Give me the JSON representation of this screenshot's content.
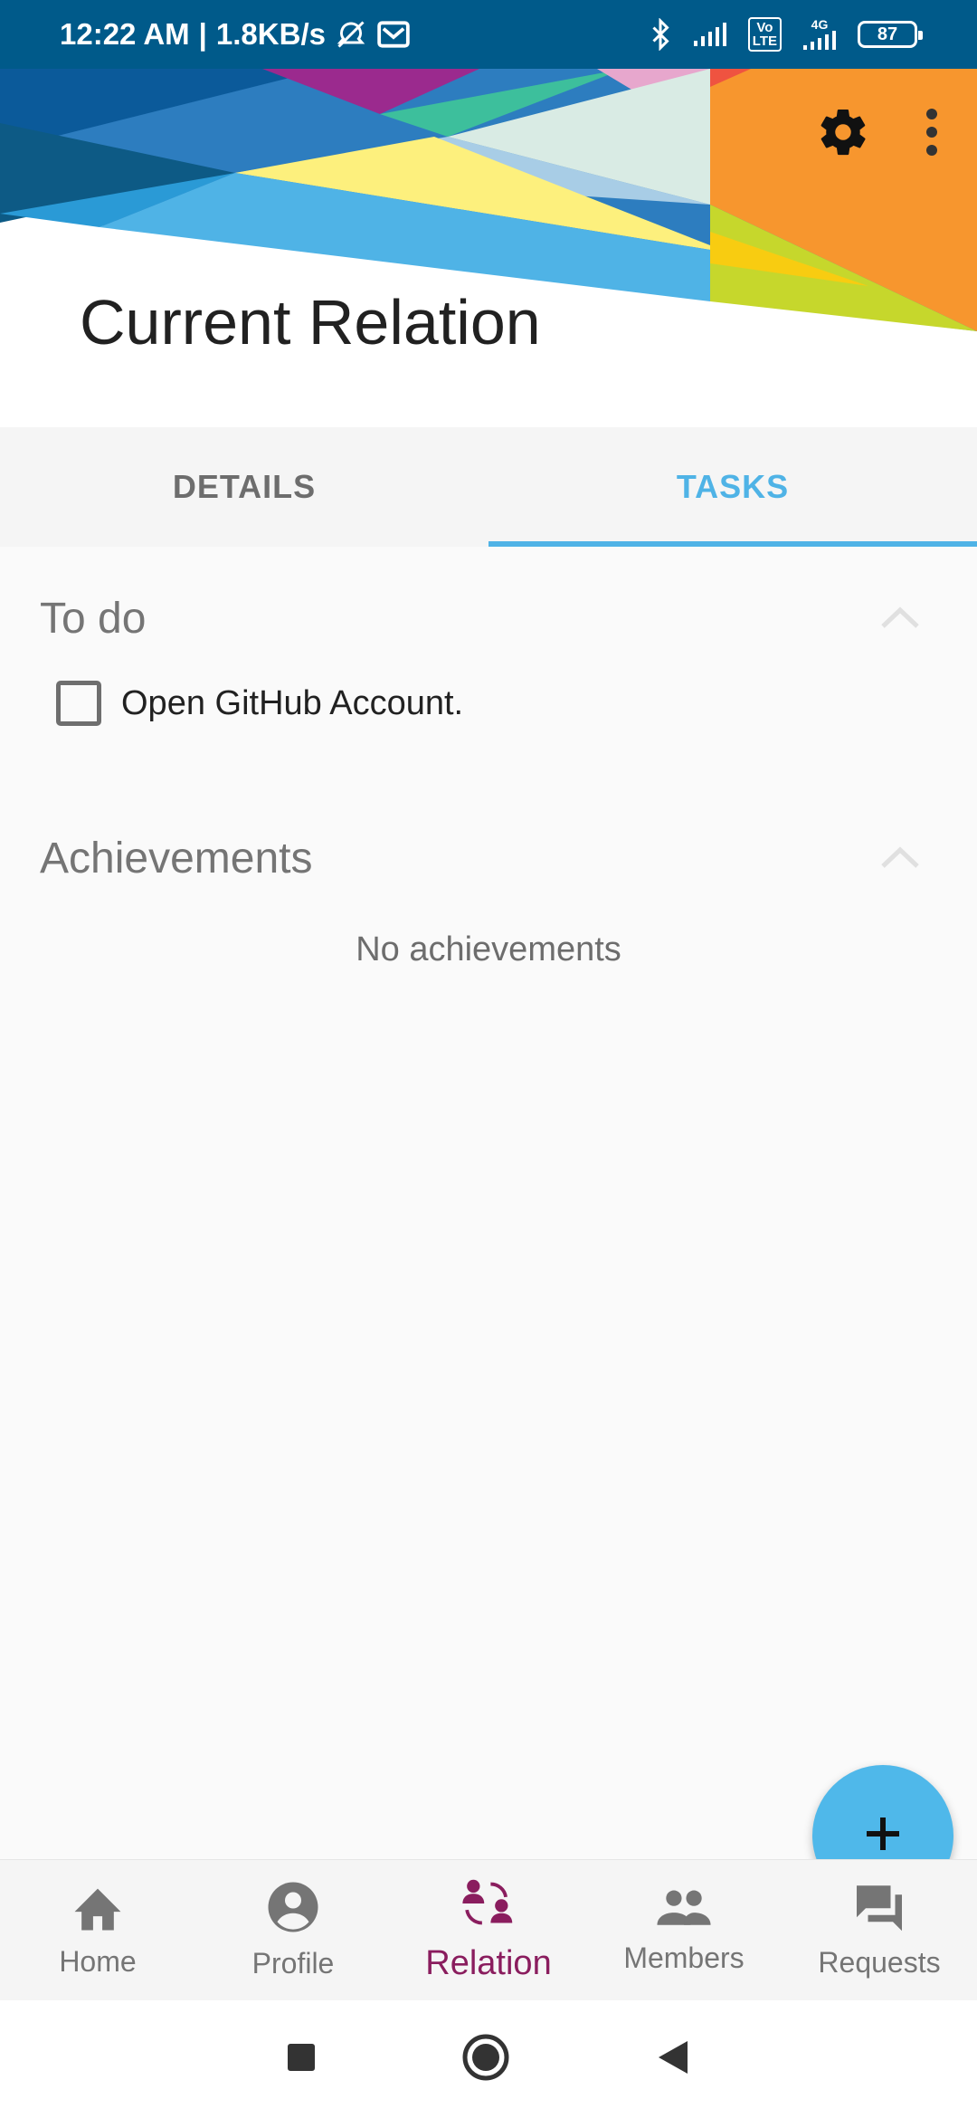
{
  "status_bar": {
    "time": "12:22 AM",
    "net_speed": "1.8KB/s",
    "separator": "|",
    "lte_label_top": "Vo",
    "lte_label_bottom": "LTE",
    "network_4g": "4G",
    "battery": "87"
  },
  "header": {
    "title": "Current Relation",
    "settings_icon": "gear-icon",
    "more_icon": "more-vertical-icon"
  },
  "tabs": [
    {
      "label": "DETAILS",
      "active": false
    },
    {
      "label": "TASKS",
      "active": true
    }
  ],
  "todo": {
    "title": "To do",
    "collapse_icon": "chevron-up-icon",
    "items": [
      {
        "label": "Open GitHub Account.",
        "checked": false
      }
    ]
  },
  "achievements": {
    "title": "Achievements",
    "collapse_icon": "chevron-up-icon",
    "empty_text": "No achievements"
  },
  "fab": {
    "icon": "plus-icon"
  },
  "bottom_nav": [
    {
      "label": "Home",
      "icon": "home-icon",
      "active": false
    },
    {
      "label": "Profile",
      "icon": "account-circle-icon",
      "active": false
    },
    {
      "label": "Relation",
      "icon": "relation-icon",
      "active": true
    },
    {
      "label": "Members",
      "icon": "people-icon",
      "active": false
    },
    {
      "label": "Requests",
      "icon": "chat-icon",
      "active": false
    }
  ],
  "colors": {
    "status_bar": "#005a8a",
    "accent": "#4fb3e6",
    "active_nav": "#8a1d5e",
    "fab": "#4fb8ea"
  }
}
